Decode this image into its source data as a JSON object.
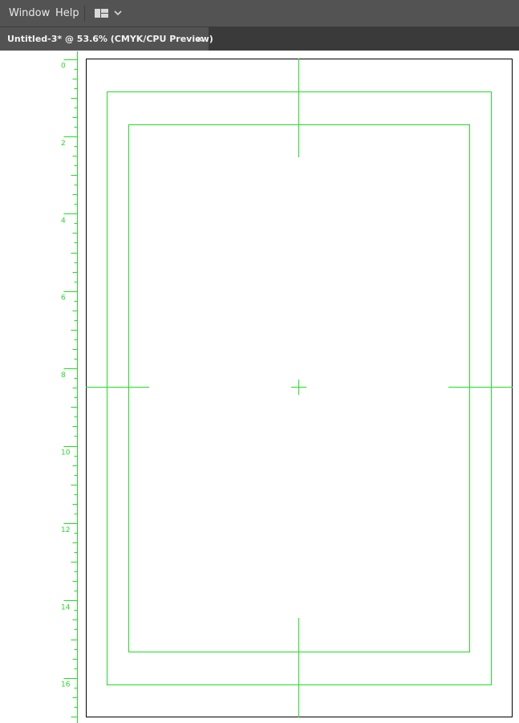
{
  "menubar": {
    "items": [
      {
        "id": "window",
        "label": "Window"
      },
      {
        "id": "help",
        "label": "Help"
      }
    ],
    "workspace_switcher_icon": "workspace-layout-icon",
    "workspace_switcher_arrow_icon": "chevron-down-icon"
  },
  "tab": {
    "title": "Untitled-3* @ 53.6% (CMYK/CPU Preview)",
    "close_glyph": "×"
  },
  "ruler": {
    "labels": [
      "0",
      "2",
      "4",
      "6",
      "8",
      "10",
      "12",
      "14",
      "16"
    ],
    "color": "#22dd22"
  },
  "guides": {
    "color": "#22dd22"
  },
  "colors": {
    "menubar_bg": "#535353",
    "tabbar_bg": "#3a3a3a",
    "active_tab_bg": "#535353",
    "artboard_border": "#000000"
  }
}
